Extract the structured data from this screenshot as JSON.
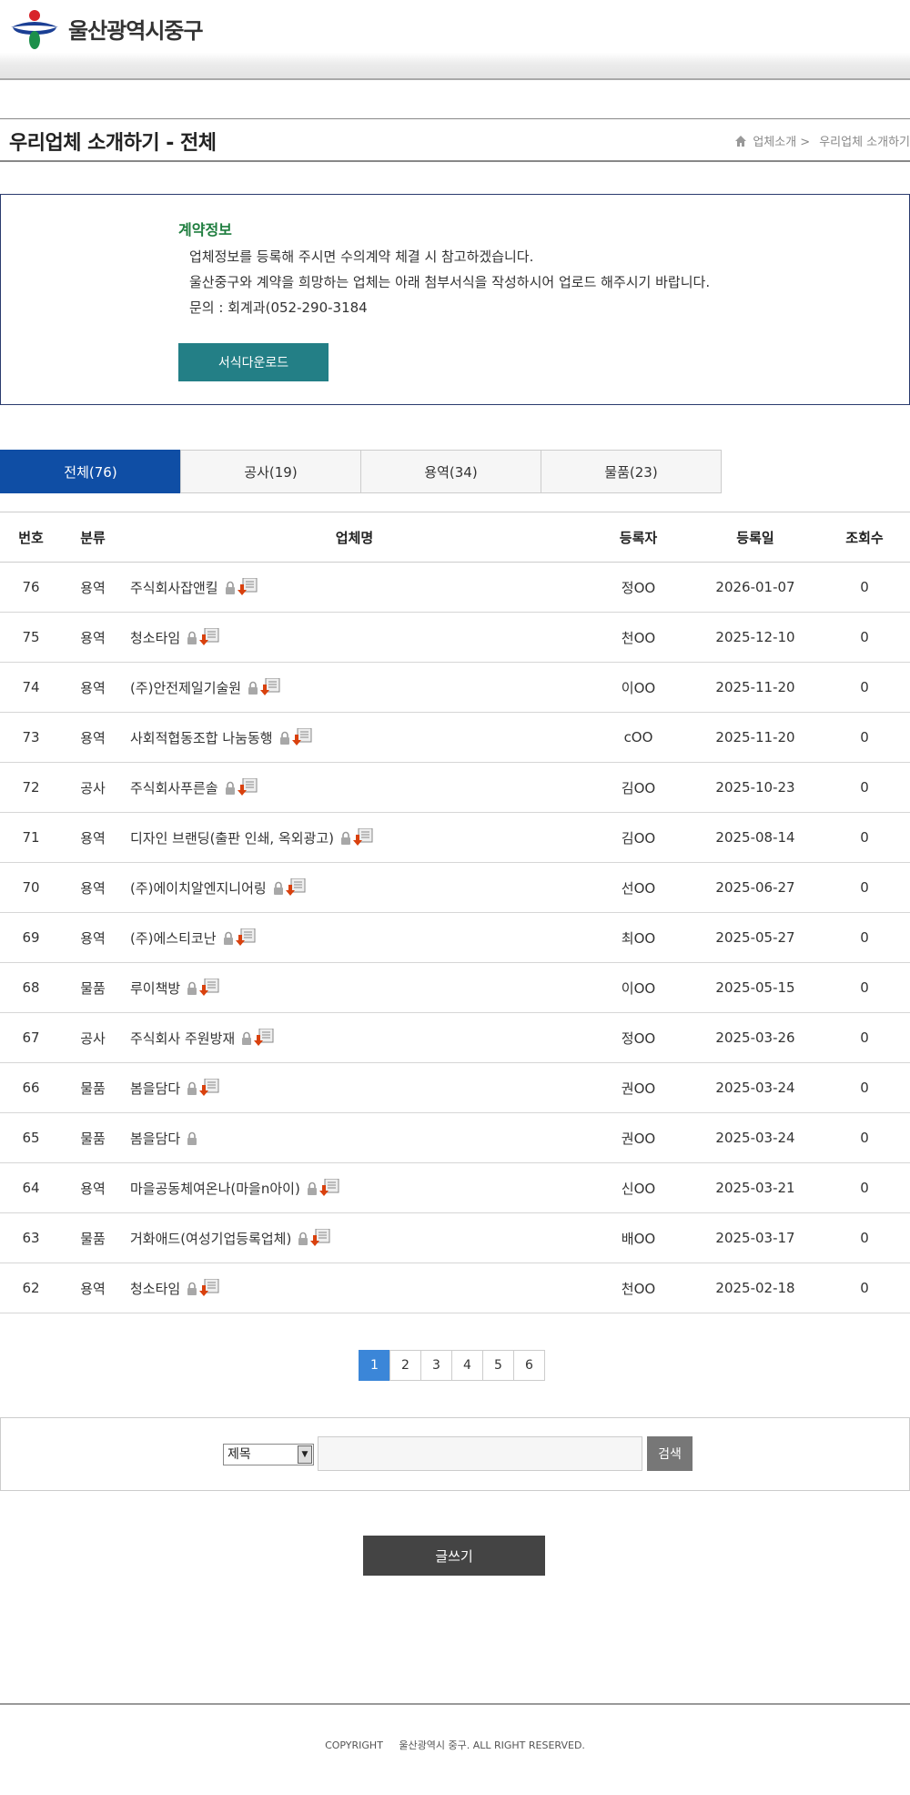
{
  "header": {
    "site_name": "울산광역시중구"
  },
  "titlebar": {
    "title": "우리업체 소개하기 - 전체",
    "breadcrumb": [
      "업체소개 >",
      "우리업체 소개하기"
    ]
  },
  "info": {
    "title": "계약정보",
    "lines": [
      "업체정보를 등록해 주시면 수의계약 체결 시 참고하겠습니다.",
      "울산중구와 계약을 희망하는 업체는 아래 첨부서식을 작성하시어 업로드 해주시기 바랍니다.",
      "문의 : 회계과(052-290-3184"
    ],
    "download_label": "서식다운로드"
  },
  "tabs": [
    {
      "label": "전체(76)",
      "active": true
    },
    {
      "label": "공사(19)",
      "active": false
    },
    {
      "label": "용역(34)",
      "active": false
    },
    {
      "label": "물품(23)",
      "active": false
    }
  ],
  "table": {
    "headers": [
      "번호",
      "분류",
      "업체명",
      "등록자",
      "등록일",
      "조회수"
    ],
    "rows": [
      {
        "no": "76",
        "cat": "용역",
        "name": "주식회사잡앤킬",
        "file": true,
        "user": "정OO",
        "date": "2026-01-07",
        "views": "0"
      },
      {
        "no": "75",
        "cat": "용역",
        "name": "청소타임",
        "file": true,
        "user": "천OO",
        "date": "2025-12-10",
        "views": "0"
      },
      {
        "no": "74",
        "cat": "용역",
        "name": "(주)안전제일기술원",
        "file": true,
        "user": "이OO",
        "date": "2025-11-20",
        "views": "0"
      },
      {
        "no": "73",
        "cat": "용역",
        "name": "사회적협동조합 나눔동행",
        "file": true,
        "user": "cOO",
        "date": "2025-11-20",
        "views": "0"
      },
      {
        "no": "72",
        "cat": "공사",
        "name": "주식회사푸른솔",
        "file": true,
        "user": "김OO",
        "date": "2025-10-23",
        "views": "0"
      },
      {
        "no": "71",
        "cat": "용역",
        "name": "디자인 브랜딩(출판 인쇄, 옥외광고)",
        "file": true,
        "user": "김OO",
        "date": "2025-08-14",
        "views": "0"
      },
      {
        "no": "70",
        "cat": "용역",
        "name": "(주)에이치알엔지니어링",
        "file": true,
        "user": "선OO",
        "date": "2025-06-27",
        "views": "0"
      },
      {
        "no": "69",
        "cat": "용역",
        "name": "(주)에스티코난",
        "file": true,
        "user": "최OO",
        "date": "2025-05-27",
        "views": "0"
      },
      {
        "no": "68",
        "cat": "물품",
        "name": "루이책방",
        "file": true,
        "user": "이OO",
        "date": "2025-05-15",
        "views": "0"
      },
      {
        "no": "67",
        "cat": "공사",
        "name": "주식회사 주원방재",
        "file": true,
        "user": "정OO",
        "date": "2025-03-26",
        "views": "0"
      },
      {
        "no": "66",
        "cat": "물품",
        "name": "봄을담다",
        "file": true,
        "user": "권OO",
        "date": "2025-03-24",
        "views": "0"
      },
      {
        "no": "65",
        "cat": "물품",
        "name": "봄을담다",
        "file": false,
        "user": "권OO",
        "date": "2025-03-24",
        "views": "0"
      },
      {
        "no": "64",
        "cat": "용역",
        "name": "마을공동체여온나(마을n아이)",
        "file": true,
        "user": "신OO",
        "date": "2025-03-21",
        "views": "0"
      },
      {
        "no": "63",
        "cat": "물품",
        "name": "거화애드(여성기업등록업체)",
        "file": true,
        "user": "배OO",
        "date": "2025-03-17",
        "views": "0"
      },
      {
        "no": "62",
        "cat": "용역",
        "name": "청소타임",
        "file": true,
        "user": "천OO",
        "date": "2025-02-18",
        "views": "0"
      }
    ]
  },
  "pagination": {
    "pages": [
      "1",
      "2",
      "3",
      "4",
      "5",
      "6"
    ],
    "current": "1"
  },
  "search": {
    "select_value": "제목",
    "button_label": "검색"
  },
  "write_label": "글쓰기",
  "footer": {
    "copyright": "COPYRIGHT     울산광역시 중구. ALL RIGHT RESERVED."
  },
  "colors": {
    "tab_active": "#0f4ea5",
    "download_btn": "#237f86",
    "info_title": "#1e7d3e",
    "page_active": "#3b86d8"
  }
}
